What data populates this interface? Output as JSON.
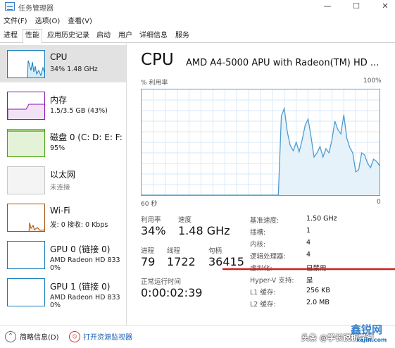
{
  "window": {
    "title": "任务管理器",
    "min": "—",
    "max": "☐",
    "close": "✕"
  },
  "menu": [
    "文件(F)",
    "选项(O)",
    "查看(V)"
  ],
  "tabs": [
    {
      "label": "进程"
    },
    {
      "label": "性能",
      "active": true
    },
    {
      "label": "应用历史记录"
    },
    {
      "label": "启动"
    },
    {
      "label": "用户"
    },
    {
      "label": "详细信息"
    },
    {
      "label": "服务"
    }
  ],
  "sidebar": {
    "items": [
      {
        "title": "CPU",
        "line1": "34% 1.48 GHz",
        "line2": "",
        "color": "#117dbb",
        "selected": true
      },
      {
        "title": "内存",
        "line1": "1.5/3.5 GB (43%)",
        "line2": "",
        "color": "#8b12ae"
      },
      {
        "title": "磁盘 0 (C: D: E: F:",
        "line1": "95%",
        "line2": "",
        "color": "#4da60c"
      },
      {
        "title": "以太网",
        "line1": "未连接",
        "line2": "",
        "color": "#a0a0a0"
      },
      {
        "title": "Wi-Fi",
        "line1": "发: 0 接收: 0 Kbps",
        "line2": "",
        "color": "#a74f01"
      },
      {
        "title": "GPU 0 (链接 0)",
        "line1": "AMD Radeon HD 833",
        "line2": "0%",
        "color": "#117dbb"
      },
      {
        "title": "GPU 1 (链接 0)",
        "line1": "AMD Radeon HD 833",
        "line2": "0%",
        "color": "#117dbb"
      }
    ]
  },
  "main": {
    "title": "CPU",
    "model": "AMD A4-5000 APU with Radeon(TM) HD ...",
    "graph_label": "% 利用率",
    "graph_max": "100%",
    "graph_time": "60 秒",
    "graph_min": "0",
    "stats": {
      "utilization_label": "利用率",
      "utilization": "34%",
      "speed_label": "速度",
      "speed": "1.48 GHz",
      "processes_label": "进程",
      "processes": "79",
      "threads_label": "线程",
      "threads": "1722",
      "handles_label": "句柄",
      "handles": "36415",
      "uptime_label": "正常运行时间",
      "uptime": "0:00:02:39"
    },
    "info": [
      {
        "key": "基准速度:",
        "value": "1.50 GHz"
      },
      {
        "key": "插槽:",
        "value": "1"
      },
      {
        "key": "内核:",
        "value": "4"
      },
      {
        "key": "逻辑处理器:",
        "value": "4"
      },
      {
        "key": "虚拟化:",
        "value": "已禁用"
      },
      {
        "key": "Hyper-V 支持:",
        "value": "是"
      },
      {
        "key": "L1 缓存:",
        "value": "256 KB"
      },
      {
        "key": "L2 缓存:",
        "value": "2.0 MB"
      }
    ],
    "graph_series": [
      0,
      0,
      0,
      0,
      0,
      0,
      0,
      0,
      0,
      0,
      0,
      0,
      0,
      0,
      0,
      0,
      0,
      0,
      0,
      0,
      0,
      0,
      0,
      0,
      0,
      0,
      0,
      0,
      0,
      0,
      0,
      0,
      0,
      0,
      0,
      0,
      0,
      0,
      0,
      0,
      0,
      0,
      0,
      0,
      0,
      0,
      0,
      75,
      82,
      60,
      47,
      42,
      50,
      41,
      52,
      66,
      72,
      55,
      36,
      40,
      46,
      36,
      44,
      40,
      52,
      70,
      62,
      58,
      76,
      54,
      45,
      40,
      22,
      24,
      40,
      38,
      30,
      26,
      34,
      32,
      28
    ]
  },
  "footer": {
    "brief_icon": "⌃",
    "brief": "简略信息(D)",
    "monitor_icon": "⦸",
    "monitor": "打开资源监视器",
    "watermark": "头条 @学长锐析导资",
    "wm_logo": "鑫锐网",
    "wm_url": "xajin.com"
  }
}
